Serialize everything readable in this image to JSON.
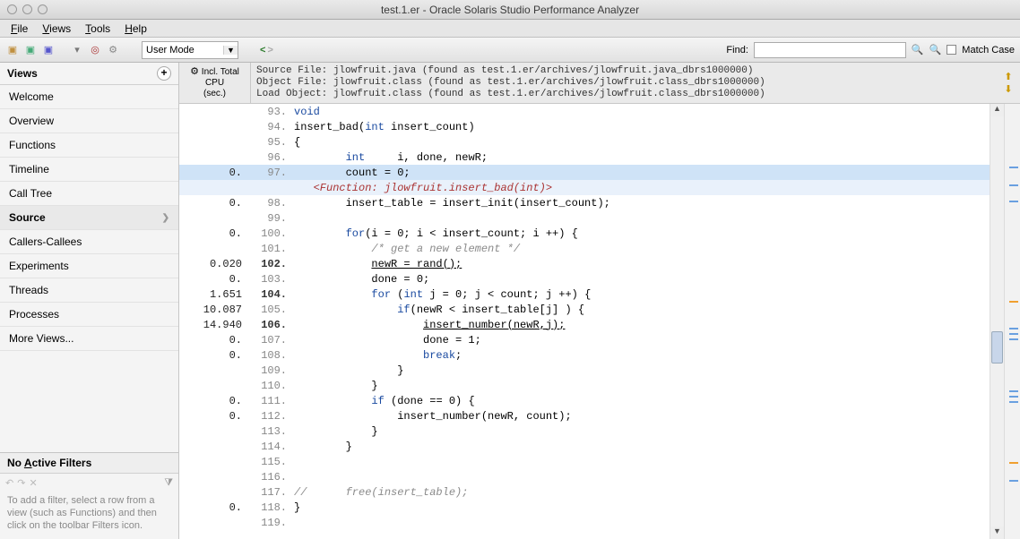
{
  "window": {
    "title": "test.1.er  -  Oracle Solaris Studio Performance Analyzer"
  },
  "menu": {
    "file": "File",
    "views": "Views",
    "tools": "Tools",
    "help": "Help"
  },
  "toolbar": {
    "mode": "User Mode",
    "find_label": "Find:",
    "find_value": "",
    "match_case": "Match Case"
  },
  "sidebar": {
    "header": "Views",
    "items": [
      {
        "label": "Welcome"
      },
      {
        "label": "Overview"
      },
      {
        "label": "Functions"
      },
      {
        "label": "Timeline"
      },
      {
        "label": "Call Tree"
      },
      {
        "label": "Source",
        "selected": true
      },
      {
        "label": "Callers-Callees"
      },
      {
        "label": "Experiments"
      },
      {
        "label": "Threads"
      },
      {
        "label": "Processes"
      },
      {
        "label": "More Views..."
      }
    ],
    "filters_header": "No Active Filters",
    "filters_help": "To add a filter, select a row from a view (such as Functions) and then click on the toolbar Filters icon."
  },
  "metric_header": {
    "l1": "Incl. Total",
    "l2": "CPU",
    "l3": "(sec.)"
  },
  "fileinfo": "Source File: jlowfruit.java (found as test.1.er/archives/jlowfruit.java_dbrs1000000)\nObject File: jlowfruit.class (found as test.1.er/archives/jlowfruit.class_dbrs1000000)\nLoad Object: jlowfruit.class (found as test.1.er/archives/jlowfruit.class_dbrs1000000)",
  "source": [
    {
      "m": "",
      "ln": "93.",
      "code": "void",
      "kw": true
    },
    {
      "m": "",
      "ln": "94.",
      "code_parts": [
        {
          "t": "insert_bad(",
          "c": ""
        },
        {
          "t": "int",
          "c": "kw"
        },
        {
          "t": " insert_count)",
          "c": ""
        }
      ]
    },
    {
      "m": "",
      "ln": "95.",
      "code": "{"
    },
    {
      "m": "",
      "ln": "96.",
      "code_parts": [
        {
          "t": "        ",
          "c": ""
        },
        {
          "t": "int",
          "c": "kw"
        },
        {
          "t": "     i, done, newR;",
          "c": ""
        }
      ]
    },
    {
      "m": "0.",
      "ln": "97.",
      "hl": true,
      "code": "        count = 0;"
    },
    {
      "m": "",
      "ln": "",
      "hl2": true,
      "func": "<Function: jlowfruit.insert_bad(int)>"
    },
    {
      "m": "0.",
      "ln": "98.",
      "code": "        insert_table = insert_init(insert_count);"
    },
    {
      "m": "",
      "ln": "99.",
      "code": ""
    },
    {
      "m": "0.",
      "ln": "100.",
      "code_parts": [
        {
          "t": "        ",
          "c": ""
        },
        {
          "t": "for",
          "c": "kw"
        },
        {
          "t": "(i = 0; i < insert_count; i ++) {",
          "c": ""
        }
      ]
    },
    {
      "m": "",
      "ln": "101.",
      "code_parts": [
        {
          "t": "            ",
          "c": ""
        },
        {
          "t": "/* get a new element */",
          "c": "cm"
        }
      ]
    },
    {
      "m": "0.020",
      "ln": "102.",
      "bold": true,
      "code_parts": [
        {
          "t": "            ",
          "c": ""
        },
        {
          "t": "newR = rand();",
          "c": "ul"
        }
      ]
    },
    {
      "m": "0.",
      "ln": "103.",
      "code": "            done = 0;"
    },
    {
      "m": "1.651",
      "ln": "104.",
      "bold": true,
      "code_parts": [
        {
          "t": "            ",
          "c": ""
        },
        {
          "t": "for",
          "c": "kw"
        },
        {
          "t": " (",
          "c": ""
        },
        {
          "t": "int",
          "c": "kw"
        },
        {
          "t": " j = 0; j < count; j ++) {",
          "c": ""
        }
      ]
    },
    {
      "m": "10.087",
      "ln": "105.",
      "code_parts": [
        {
          "t": "                ",
          "c": ""
        },
        {
          "t": "if",
          "c": "kw"
        },
        {
          "t": "(newR < insert_table[j] ) {",
          "c": ""
        }
      ]
    },
    {
      "m": "14.940",
      "ln": "106.",
      "bold": true,
      "code_parts": [
        {
          "t": "                    ",
          "c": ""
        },
        {
          "t": "insert_number(newR,j);",
          "c": "ul"
        }
      ]
    },
    {
      "m": "0.",
      "ln": "107.",
      "code": "                    done = 1;"
    },
    {
      "m": "0.",
      "ln": "108.",
      "code_parts": [
        {
          "t": "                    ",
          "c": ""
        },
        {
          "t": "break",
          "c": "kw"
        },
        {
          "t": ";",
          "c": ""
        }
      ]
    },
    {
      "m": "",
      "ln": "109.",
      "code": "                }"
    },
    {
      "m": "",
      "ln": "110.",
      "code": "            }"
    },
    {
      "m": "0.",
      "ln": "111.",
      "code_parts": [
        {
          "t": "            ",
          "c": ""
        },
        {
          "t": "if",
          "c": "kw"
        },
        {
          "t": " (done == 0) {",
          "c": ""
        }
      ]
    },
    {
      "m": "0.",
      "ln": "112.",
      "code": "                insert_number(newR, count);"
    },
    {
      "m": "",
      "ln": "113.",
      "code": "            }"
    },
    {
      "m": "",
      "ln": "114.",
      "code": "        }"
    },
    {
      "m": "",
      "ln": "115.",
      "code": ""
    },
    {
      "m": "",
      "ln": "116.",
      "code": ""
    },
    {
      "m": "",
      "ln": "117.",
      "code_parts": [
        {
          "t": "//      free(insert_table);",
          "c": "cm"
        }
      ]
    },
    {
      "m": "0.",
      "ln": "118.",
      "code": "}"
    },
    {
      "m": "",
      "ln": "119.",
      "code": ""
    }
  ]
}
